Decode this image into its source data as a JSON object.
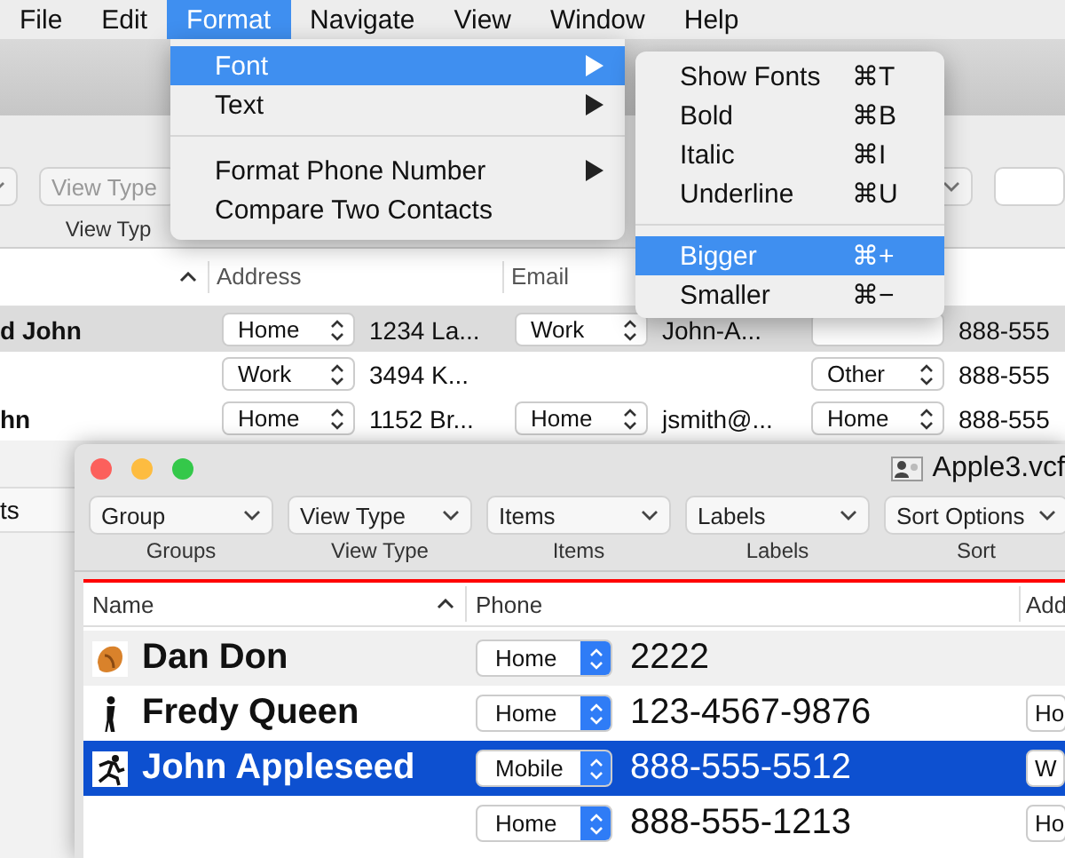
{
  "menu_bar": {
    "items": [
      {
        "label": "File",
        "selected": false
      },
      {
        "label": "Edit",
        "selected": false
      },
      {
        "label": "Format",
        "selected": true
      },
      {
        "label": "Navigate",
        "selected": false
      },
      {
        "label": "View",
        "selected": false
      },
      {
        "label": "Window",
        "selected": false
      },
      {
        "label": "Help",
        "selected": false
      }
    ]
  },
  "format_menu": {
    "groups": [
      [
        {
          "label": "Font",
          "selected": true,
          "submenu": true
        },
        {
          "label": "Text",
          "selected": false,
          "submenu": true
        }
      ],
      [
        {
          "label": "Format Phone Number",
          "selected": false,
          "submenu": true
        },
        {
          "label": "Compare Two Contacts",
          "selected": false,
          "submenu": false
        }
      ]
    ]
  },
  "font_submenu": {
    "groups": [
      [
        {
          "label": "Show Fonts",
          "shortcut": "⌘T",
          "selected": false
        },
        {
          "label": "Bold",
          "shortcut": "⌘B",
          "selected": false
        },
        {
          "label": "Italic",
          "shortcut": "⌘I",
          "selected": false
        },
        {
          "label": "Underline",
          "shortcut": "⌘U",
          "selected": false
        }
      ],
      [
        {
          "label": "Bigger",
          "shortcut": "⌘+",
          "selected": true
        },
        {
          "label": "Smaller",
          "shortcut": "⌘−",
          "selected": false
        }
      ]
    ]
  },
  "back_window": {
    "toolbar": {
      "popup": "View Type",
      "caption": "View Typ"
    },
    "table": {
      "columns": [
        "Address",
        "Email"
      ],
      "rows": [
        {
          "name": "d John",
          "selected": true,
          "address_label": "Home",
          "address": "1234 La...",
          "email_label": "Work",
          "email": "John-A...",
          "phone": "888-555"
        },
        {
          "selected": false,
          "address_label": "Work",
          "address": "3494 K...",
          "phone_label": "Other",
          "phone": "888-555"
        },
        {
          "name": "hn",
          "selected": false,
          "address_label": "Home",
          "address": "1152 Br...",
          "email_label": "Home",
          "email": "jsmith@...",
          "phone_label": "Home",
          "phone": "888-555"
        }
      ]
    },
    "sidebar": {
      "item": "ts"
    }
  },
  "front_window": {
    "title": "Apple3.vcf",
    "toolbar": [
      {
        "popup": "Group",
        "caption": "Groups"
      },
      {
        "popup": "View Type",
        "caption": "View Type"
      },
      {
        "popup": "Items",
        "caption": "Items"
      },
      {
        "popup": "Labels",
        "caption": "Labels"
      },
      {
        "popup": "Sort Options",
        "caption": "Sort"
      }
    ],
    "table": {
      "columns": [
        "Name",
        "Phone",
        "Add"
      ],
      "rows": [
        {
          "name": "Dan Don",
          "avatar": {
            "kind": "cookie"
          },
          "selected": false,
          "phone_label": "Home",
          "phone": "2222"
        },
        {
          "name": "Fredy Queen",
          "avatar": {
            "kind": "figure"
          },
          "selected": false,
          "phone_label": "Home",
          "phone": "123-4567-9876",
          "next_label": "Ho"
        },
        {
          "name": "John Appleseed",
          "avatar": {
            "kind": "runner"
          },
          "selected": true,
          "phone_label": "Mobile",
          "phone": "888-555-5512",
          "next_label": "W"
        },
        {
          "selected": false,
          "phone_label": "Home",
          "phone": "888-555-1213",
          "next_label": "Ho"
        }
      ]
    }
  }
}
